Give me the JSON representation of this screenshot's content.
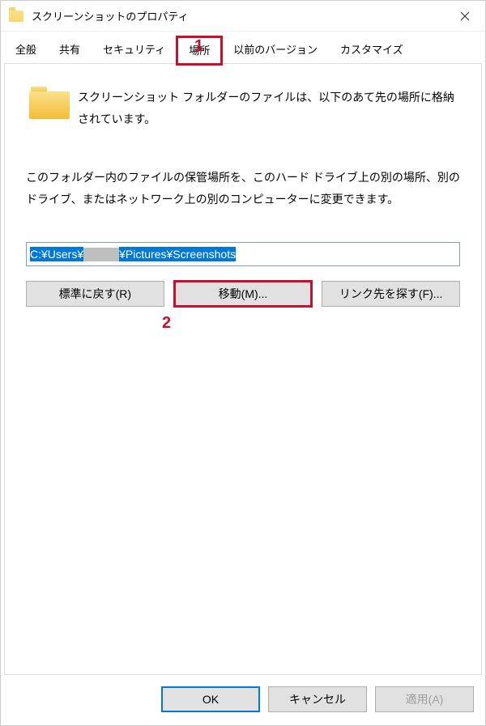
{
  "title": "スクリーンショットのプロパティ",
  "tabs": {
    "general": "全般",
    "sharing": "共有",
    "security": "セキュリティ",
    "location": "場所",
    "previous": "以前のバージョン",
    "customize": "カスタマイズ"
  },
  "content": {
    "intro": "スクリーンショット フォルダーのファイルは、以下のあて先の場所に格納されています。",
    "desc": "このフォルダー内のファイルの保管場所を、このハード ドライブ上の別の場所、別のドライブ、またはネットワーク上の別のコンピューターに変更できます。",
    "path_prefix": "C:¥Users¥",
    "path_suffix": "¥Pictures¥Screenshots"
  },
  "buttons": {
    "restore": "標準に戻す(R)",
    "move": "移動(M)...",
    "find": "リンク先を探す(F)..."
  },
  "footer": {
    "ok": "OK",
    "cancel": "キャンセル",
    "apply": "適用(A)"
  },
  "callouts": {
    "one": "1",
    "two": "2"
  }
}
